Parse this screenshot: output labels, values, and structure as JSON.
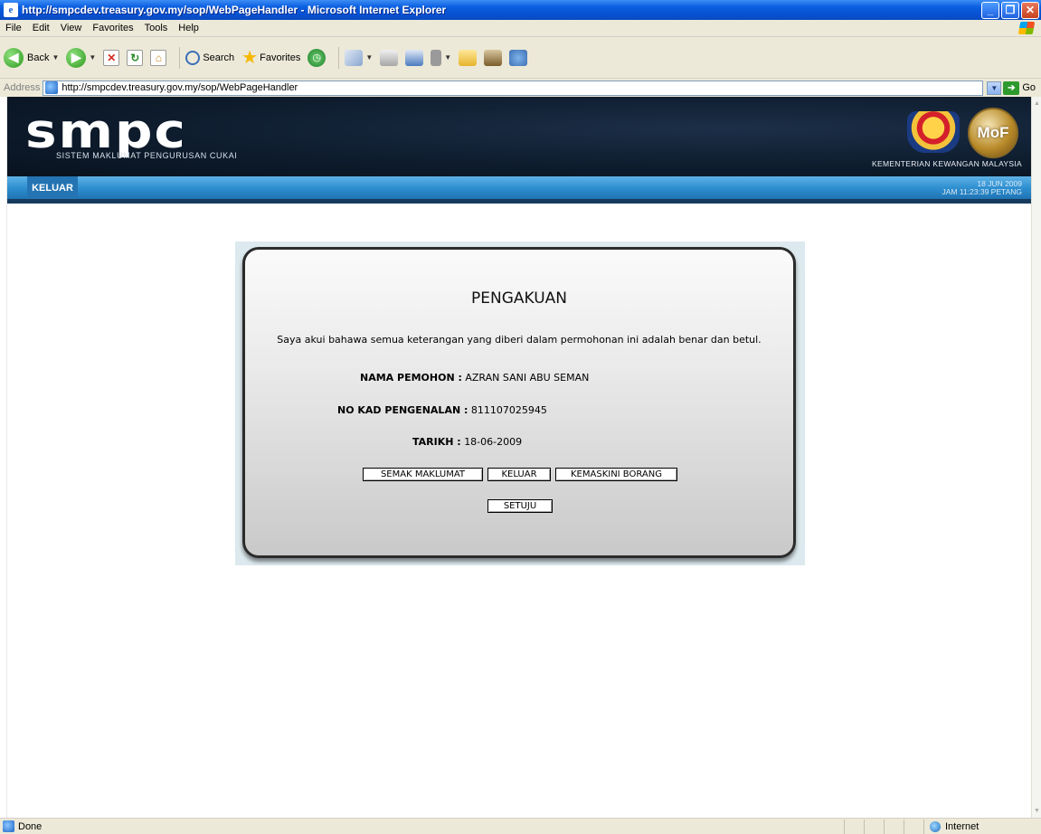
{
  "window": {
    "title": "http://smpcdev.treasury.gov.my/sop/WebPageHandler - Microsoft Internet Explorer"
  },
  "menu": [
    "File",
    "Edit",
    "View",
    "Favorites",
    "Tools",
    "Help"
  ],
  "toolbar": {
    "back_label": "Back",
    "search_label": "Search",
    "favorites_label": "Favorites"
  },
  "address": {
    "label": "Address",
    "url": "http://smpcdev.treasury.gov.my/sop/WebPageHandler",
    "go_label": "Go"
  },
  "header": {
    "logo_text": "smpc",
    "logo_subtitle": "SISTEM MAKLUMAT PENGURUSAN CUKAI",
    "ministry": "KEMENTERIAN KEWANGAN MALAYSIA",
    "badge_text": "MoF"
  },
  "nav": {
    "keluar": "KELUAR",
    "date": "18 JUN 2009",
    "time": "JAM 11:23:39 PETANG"
  },
  "form": {
    "title": "PENGAKUAN",
    "declaration": "Saya akui bahawa semua keterangan yang diberi dalam permohonan ini adalah benar dan betul.",
    "name_label": "NAMA PEMOHON :",
    "name_value": "AZRAN SANI ABU SEMAN",
    "ic_label": "NO KAD PENGENALAN :",
    "ic_value": "811107025945",
    "date_label": "TARIKH :",
    "date_value": "18-06-2009",
    "btn_semak": "SEMAK MAKLUMAT",
    "btn_keluar": "KELUAR",
    "btn_kemaskini": "KEMASKINI BORANG",
    "btn_setuju": "SETUJU"
  },
  "status": {
    "text": "Done",
    "zone": "Internet"
  },
  "colors": {
    "titlebar": "#0a5fe0",
    "header_bg": "#0d1b2c",
    "nav_bar": "#2f8fd0",
    "panel_bg": "#dce9ee"
  }
}
